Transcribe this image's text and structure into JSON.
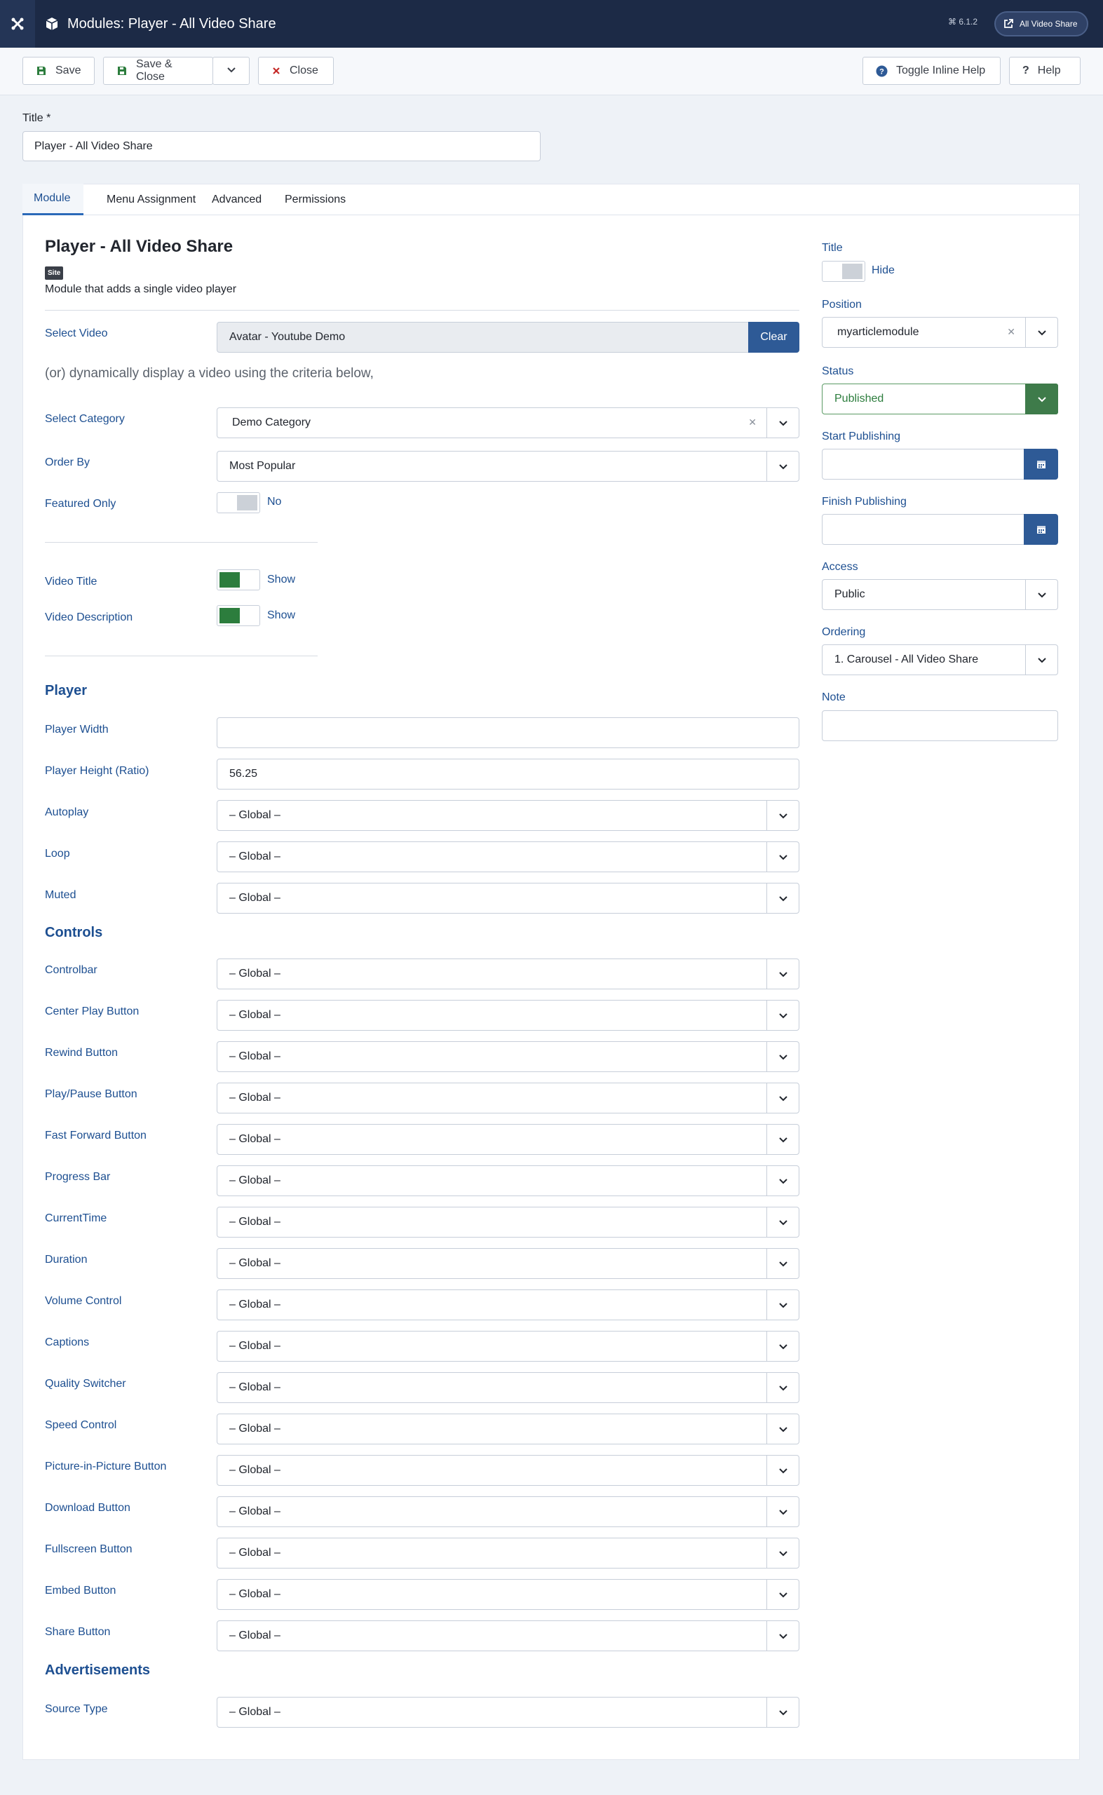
{
  "header": {
    "title": "Modules: Player - All Video Share",
    "version": "⌘ 6.1.2",
    "site_button": "All Video Share"
  },
  "toolbar": {
    "save": "Save",
    "save_close": "Save & Close",
    "close": "Close",
    "toggle_help": "Toggle Inline Help",
    "help": "Help"
  },
  "title_field": {
    "label": "Title *",
    "value": "Player - All Video Share"
  },
  "tabs": [
    "Module",
    "Menu Assignment",
    "Advanced",
    "Permissions"
  ],
  "module": {
    "heading": "Player - All Video Share",
    "badge": "Site",
    "description": "Module that adds a single video player"
  },
  "fields": {
    "select_video": {
      "label": "Select Video",
      "value": "Avatar - Youtube Demo",
      "clear": "Clear"
    },
    "dynamic_note": "(or) dynamically display a video using the criteria below,",
    "select_category": {
      "label": "Select Category",
      "value": "Demo Category"
    },
    "order_by": {
      "label": "Order By",
      "value": "Most Popular"
    },
    "featured_only": {
      "label": "Featured Only",
      "value": "No"
    },
    "video_title": {
      "label": "Video Title",
      "value": "Show"
    },
    "video_description": {
      "label": "Video Description",
      "value": "Show"
    }
  },
  "player": {
    "heading": "Player",
    "width": {
      "label": "Player Width",
      "value": ""
    },
    "height": {
      "label": "Player Height (Ratio)",
      "value": "56.25"
    },
    "selects": [
      {
        "label": "Autoplay",
        "value": "– Global –"
      },
      {
        "label": "Loop",
        "value": "– Global –"
      },
      {
        "label": "Muted",
        "value": "– Global –"
      }
    ]
  },
  "controls": {
    "heading": "Controls",
    "items": [
      {
        "label": "Controlbar",
        "value": "– Global –"
      },
      {
        "label": "Center Play Button",
        "value": "– Global –"
      },
      {
        "label": "Rewind Button",
        "value": "– Global –"
      },
      {
        "label": "Play/Pause Button",
        "value": "– Global –"
      },
      {
        "label": "Fast Forward Button",
        "value": "– Global –"
      },
      {
        "label": "Progress Bar",
        "value": "– Global –"
      },
      {
        "label": "CurrentTime",
        "value": "– Global –"
      },
      {
        "label": "Duration",
        "value": "– Global –"
      },
      {
        "label": "Volume Control",
        "value": "– Global –"
      },
      {
        "label": "Captions",
        "value": "– Global –"
      },
      {
        "label": "Quality Switcher",
        "value": "– Global –"
      },
      {
        "label": "Speed Control",
        "value": "– Global –"
      },
      {
        "label": "Picture-in-Picture Button",
        "value": "– Global –"
      },
      {
        "label": "Download Button",
        "value": "– Global –"
      },
      {
        "label": "Fullscreen Button",
        "value": "– Global –"
      },
      {
        "label": "Embed Button",
        "value": "– Global –"
      },
      {
        "label": "Share Button",
        "value": "– Global –"
      }
    ]
  },
  "ads": {
    "heading": "Advertisements",
    "source_type": {
      "label": "Source Type",
      "value": "– Global –"
    }
  },
  "side": {
    "title": {
      "label": "Title",
      "value": "Hide"
    },
    "position": {
      "label": "Position",
      "value": "myarticlemodule"
    },
    "status": {
      "label": "Status",
      "value": "Published"
    },
    "start_publishing": {
      "label": "Start Publishing",
      "value": ""
    },
    "finish_publishing": {
      "label": "Finish Publishing",
      "value": ""
    },
    "access": {
      "label": "Access",
      "value": "Public"
    },
    "ordering": {
      "label": "Ordering",
      "value": "1. Carousel - All Video Share"
    },
    "note": {
      "label": "Note",
      "value": ""
    }
  },
  "colors": {
    "header_bg": "#1c2a46",
    "primary": "#2e5a96",
    "success": "#2c7d3d",
    "label_blue": "#1d4f91"
  }
}
